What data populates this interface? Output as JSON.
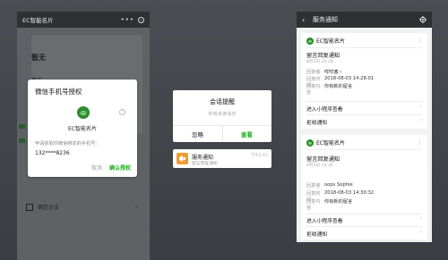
{
  "phone1": {
    "app_title": "EC智能名片",
    "capsule_dots": "•••",
    "none_title": "暂无",
    "none_sub": "暂无",
    "bottom_row_label": "绑定企业",
    "bottom_chevron": "›",
    "auth_dialog": {
      "title": "微信手机号授权",
      "app_name": "EC智能名片",
      "description": "申请获取你微信绑定的手机号:",
      "phone": "132****8236",
      "cancel_label": "取消",
      "confirm_label": "确认授权",
      "help_icon": "?"
    }
  },
  "middle": {
    "dialog": {
      "title": "会话提醒",
      "subtitle": "你有未读消息",
      "ignore_label": "忽略",
      "view_label": "查看"
    },
    "banner": {
      "title": "服务通知",
      "subtitle": "留言回复通知",
      "time": "下午2:15"
    }
  },
  "phone3": {
    "title": "服务通知",
    "back_icon": "‹",
    "cards": [
      {
        "app_name": "EC智能名片",
        "more": "⋮",
        "section_title": "留言回复通知",
        "date": "8月3日 14:28",
        "rows": [
          {
            "key": "回复者",
            "value": "咩咩酱ヽ"
          },
          {
            "key": "回复时间",
            "value": "2018-08-03 14:28:01"
          },
          {
            "key": "回复内容",
            "value": "你有新的留言"
          }
        ],
        "link_mini": "进入小程序查看",
        "link_reject": "拒收通知"
      },
      {
        "app_name": "EC智能名片",
        "more": "⋮",
        "section_title": "留言回复通知",
        "date": "8月3日 14:30",
        "rows": [
          {
            "key": "回复者",
            "value": "oops Sophie"
          },
          {
            "key": "回复时间",
            "value": "2018-08-03 14:30:32"
          },
          {
            "key": "回复内容",
            "value": "你有新的留言"
          }
        ],
        "link_mini": "进入小程序查看",
        "link_reject": "拒收通知"
      }
    ],
    "arrow": "›"
  },
  "colors": {
    "wechat_green": "#1aad19",
    "dark_bar": "#2f3032",
    "notify_orange": "#f39b2b"
  }
}
